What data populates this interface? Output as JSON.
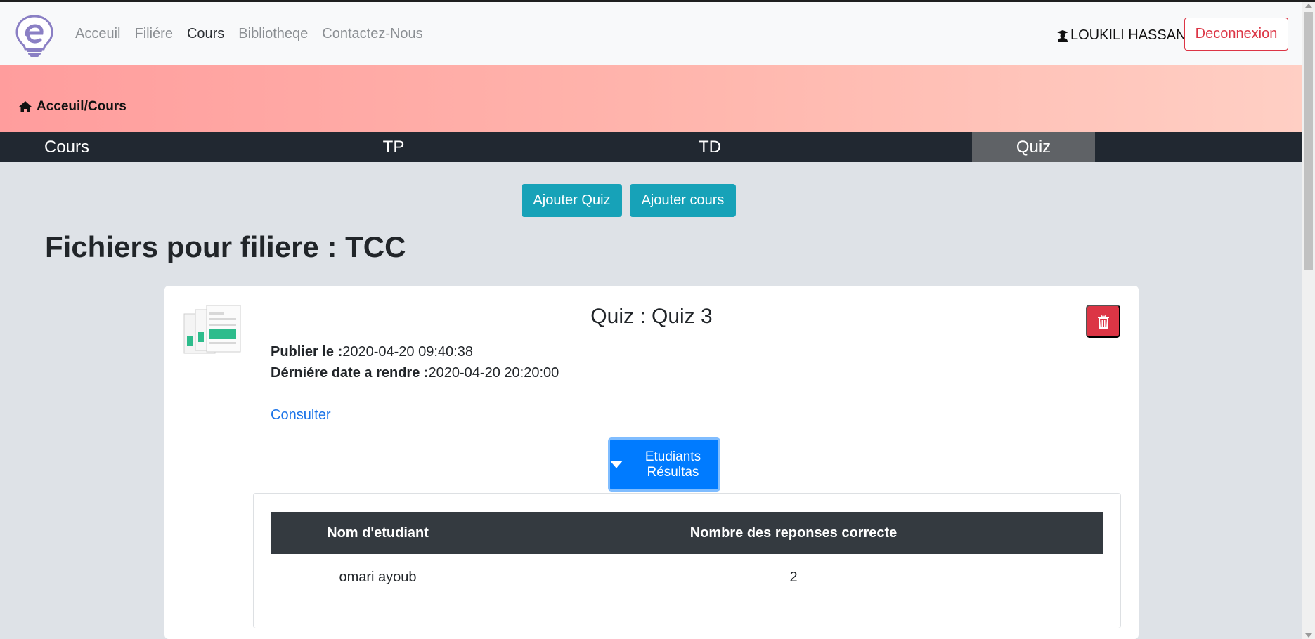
{
  "navbar": {
    "links": [
      "Acceuil",
      "Filiére",
      "Cours",
      "Bibliotheqe",
      "Contactez-Nous"
    ],
    "active_link": "Cours",
    "user_name": "LOUKILI HASSAN",
    "logout_label": "Deconnexion"
  },
  "breadcrumb": "Acceuil/Cours",
  "tabs": [
    "Cours",
    "TP",
    "TD",
    "Quiz"
  ],
  "active_tab": "Quiz",
  "actions": {
    "add_quiz": "Ajouter Quiz",
    "add_course": "Ajouter cours"
  },
  "page_title": "Fichiers pour filiere : TCC",
  "quiz_card": {
    "title": "Quiz : Quiz 3",
    "published_label": "Publier le :",
    "published_value": "2020-04-20 09:40:38",
    "deadline_label": "Dérniére date a rendre :",
    "deadline_value": "2020-04-20 20:20:00",
    "consult_link": "Consulter",
    "results_button": "Etudiants Résultas"
  },
  "results_table": {
    "headers": [
      "Nom d'etudiant",
      "Nombre des reponses correcte"
    ],
    "rows": [
      [
        "omari ayoub",
        "2"
      ]
    ]
  },
  "colors": {
    "info": "#17a2b8",
    "danger": "#dc3545",
    "primary": "#007bff",
    "dark": "#212831"
  },
  "icons": [
    "logo-bulb-icon",
    "graduation-user-icon",
    "home-icon",
    "document-icon",
    "trash-icon",
    "caret-down-icon"
  ]
}
